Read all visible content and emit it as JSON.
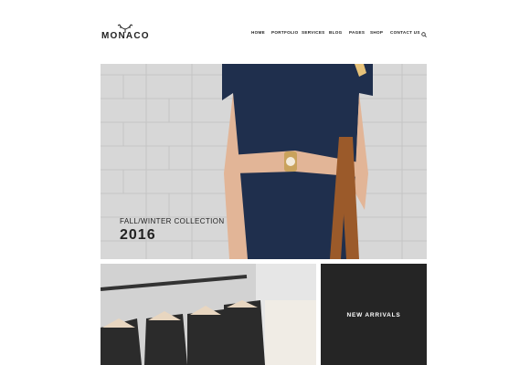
{
  "header": {
    "logo_text": "MONACO",
    "nav": [
      "HOME",
      "PORTFOLIO",
      "SERVICES",
      "BLOG",
      "PAGES",
      "SHOP",
      "CONTACT US"
    ],
    "search_icon": "search-icon"
  },
  "hero": {
    "subtitle": "FALL/WINTER COLLECTION",
    "year": "2016"
  },
  "tiles": {
    "new_arrivals": "NEW ARRIVALS"
  },
  "colors": {
    "dark_tile": "#252525",
    "text": "#222222",
    "dress": "#1f2f4d",
    "bag": "#9b5a2a"
  }
}
